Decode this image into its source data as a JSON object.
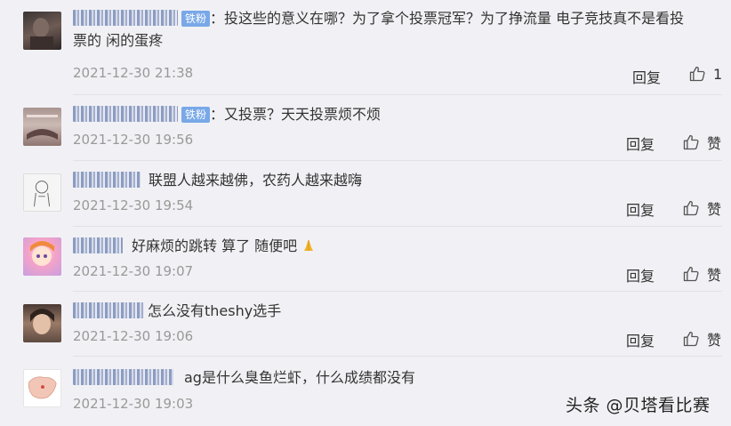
{
  "comments": [
    {
      "badge": "铁粉",
      "text": "：投这些的意义在哪？为了拿个投票冠军？为了挣流量 电子竞技真不是看投",
      "text2": "票的 闲的蛋疼",
      "time": "2021-12-30 21:38",
      "reply": "回复",
      "like": "1"
    },
    {
      "badge": "铁粉",
      "text": "：又投票？天天投票烦不烦",
      "time": "2021-12-30 19:56",
      "reply": "回复",
      "like": "赞"
    },
    {
      "text": "联盟人越来越佛，农药人越来越嗨",
      "time": "2021-12-30 19:54",
      "reply": "回复",
      "like": "赞"
    },
    {
      "text": "好麻烦的跳转 算了 随便吧",
      "time": "2021-12-30 19:07",
      "reply": "回复",
      "like": "赞"
    },
    {
      "text": "怎么没有theshy选手",
      "time": "2021-12-30 19:06",
      "reply": "回复",
      "like": "赞"
    },
    {
      "text": "ag是什么臭鱼烂虾，什么成绩都没有",
      "time": "2021-12-30 19:03"
    }
  ],
  "watermark": "头条 @贝塔看比赛",
  "colors": {
    "background": "#f1f1f5",
    "badge": "#78a8e8",
    "timestamp": "#999999"
  },
  "icons": {
    "like": "thumbs-up-icon"
  }
}
